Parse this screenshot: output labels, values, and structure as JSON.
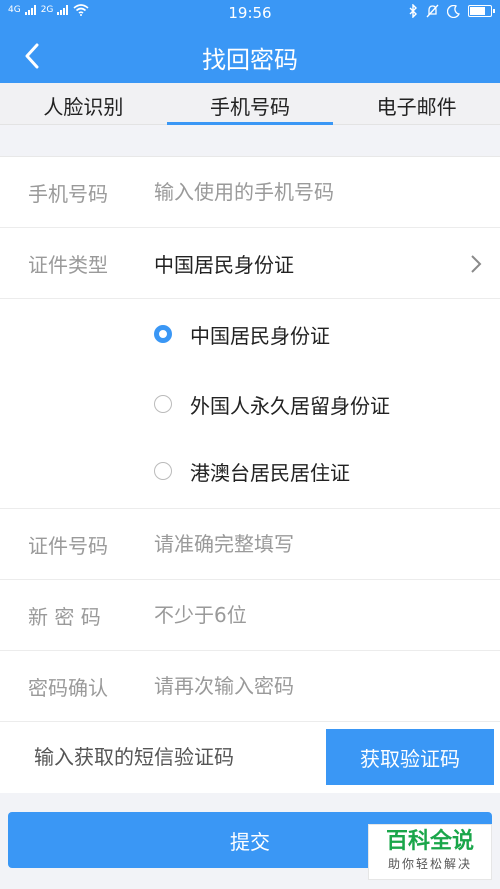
{
  "status_bar": {
    "signal_left": "4G",
    "signal_right": "2G",
    "time": "19:56"
  },
  "nav": {
    "title": "找回密码"
  },
  "tabs": [
    {
      "label": "人脸识别",
      "active": false
    },
    {
      "label": "手机号码",
      "active": true
    },
    {
      "label": "电子邮件",
      "active": false
    }
  ],
  "form": {
    "phone": {
      "label": "手机号码",
      "placeholder": "输入使用的手机号码"
    },
    "id_type": {
      "label": "证件类型",
      "value": "中国居民身份证"
    },
    "id_options": [
      {
        "label": "中国居民身份证",
        "checked": true
      },
      {
        "label": "外国人永久居留身份证",
        "checked": false
      },
      {
        "label": "港澳台居民居住证",
        "checked": false
      }
    ],
    "id_number": {
      "label": "证件号码",
      "placeholder": "请准确完整填写"
    },
    "new_password": {
      "label": "新 密 码",
      "placeholder": "不少于6位"
    },
    "confirm_password": {
      "label": "密码确认",
      "placeholder": "请再次输入密码"
    },
    "sms": {
      "placeholder": "输入获取的短信验证码",
      "button": "获取验证码"
    }
  },
  "submit_label": "提交",
  "watermark": {
    "title": "百科全说",
    "subtitle": "助你轻松解决"
  },
  "colors": {
    "primary": "#3a97f5",
    "background": "#f2f3f7",
    "watermark_green": "#1aa64a"
  }
}
